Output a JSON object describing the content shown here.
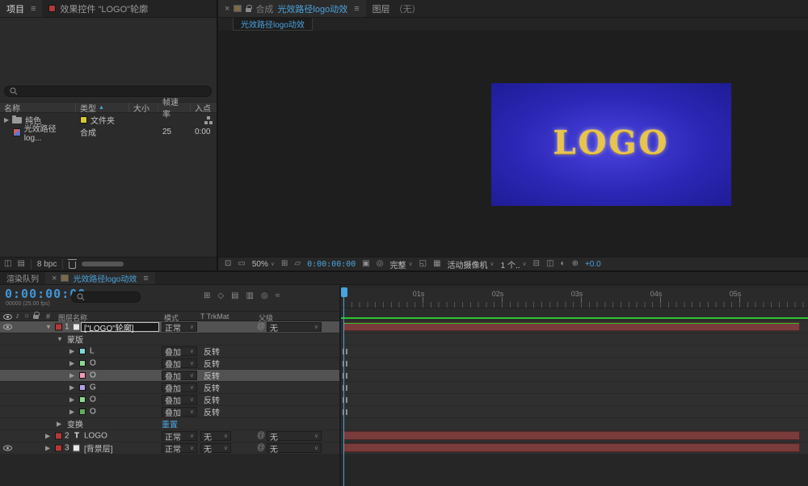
{
  "project": {
    "tab_project": "项目",
    "tab_effect_controls": "效果控件 \"LOGO\"轮廓",
    "search_placeholder": "",
    "columns": {
      "name": "名称",
      "type": "类型",
      "size": "大小",
      "rate": "帧速率",
      "in": "入点"
    },
    "rows": [
      {
        "name": "纯色",
        "type": "文件夹",
        "size": "",
        "rate": "",
        "in": ""
      },
      {
        "name": "光效路径log...",
        "type": "合成",
        "size": "",
        "rate": "25",
        "in": "0:00"
      }
    ],
    "footer": {
      "bpc": "8 bpc"
    }
  },
  "viewer": {
    "tab_comp_label": "合成",
    "comp_name": "光效路径logo动效",
    "tab_layer_label": "图层",
    "tab_layer_value": "（无）",
    "subtab": "光效路径logo动效",
    "canvas_text": "LOGO",
    "toolbar": {
      "zoom": "50%",
      "timecode": "0:00:00:00",
      "resolution": "完整",
      "camera": "活动摄像机",
      "views": "1 个..",
      "exposure": "+0.0"
    }
  },
  "timeline": {
    "tab_render_queue": "渲染队列",
    "tab_comp": "光效路径logo动效",
    "timecode": "0:00:00:00",
    "frames_info": "00000 (25.00 fps)",
    "header": {
      "num": "#",
      "layer_name": "图层名称",
      "mode": "模式",
      "trkmat": "T TrkMat",
      "parent": "父级"
    },
    "ruler": [
      "01s",
      "02s",
      "03s",
      "04s",
      "05s"
    ],
    "layers": [
      {
        "num": "1",
        "name": "[\"LOGO\"轮廓]",
        "mode": "正常",
        "parent": "无"
      },
      {
        "num": "2",
        "name": "LOGO",
        "mode": "正常",
        "trkmat": "无",
        "parent": "无"
      },
      {
        "num": "3",
        "name": "[背景层]",
        "mode": "正常",
        "trkmat": "无",
        "parent": "无"
      }
    ],
    "masks_group": "蒙版",
    "mask_mode": "叠加",
    "mask_invert": "反转",
    "masks": [
      {
        "name": "L",
        "color": "#7fd7d7"
      },
      {
        "name": "O",
        "color": "#8fd78f"
      },
      {
        "name": "O",
        "color": "#f09ab4"
      },
      {
        "name": "G",
        "color": "#b3a0e8"
      },
      {
        "name": "O",
        "color": "#8fd78f"
      },
      {
        "name": "O",
        "color": "#5fae5f"
      }
    ],
    "transform_label": "变换",
    "transform_reset": "重置"
  },
  "colors": {
    "accent_blue": "#4ba3dc",
    "timecode_blue": "#4196d6",
    "layer_bar_red": "#7a3b3b",
    "cache_green": "#2fc42f",
    "label_chip_red": "#b53838",
    "comp_bg_center": "#4a44e0",
    "comp_bg_edge": "#1f1c96",
    "logo_gold": "#e8c44a"
  }
}
